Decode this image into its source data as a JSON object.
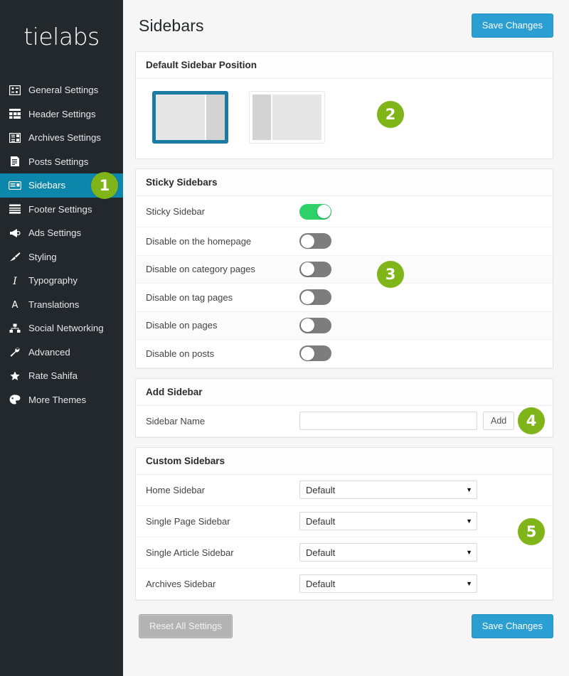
{
  "sidebar": {
    "logo": "tielabs",
    "items": [
      {
        "label": "General Settings",
        "icon": "general-settings-icon",
        "active": false
      },
      {
        "label": "Header Settings",
        "icon": "header-settings-icon",
        "active": false
      },
      {
        "label": "Archives Settings",
        "icon": "archives-settings-icon",
        "active": false
      },
      {
        "label": "Posts Settings",
        "icon": "posts-settings-icon",
        "active": false
      },
      {
        "label": "Sidebars",
        "icon": "sidebars-icon",
        "active": true
      },
      {
        "label": "Footer Settings",
        "icon": "footer-settings-icon",
        "active": false
      },
      {
        "label": "Ads Settings",
        "icon": "megaphone-icon",
        "active": false
      },
      {
        "label": "Styling",
        "icon": "brush-icon",
        "active": false
      },
      {
        "label": "Typography",
        "icon": "italic-text-icon",
        "active": false
      },
      {
        "label": "Translations",
        "icon": "letter-a-icon",
        "active": false
      },
      {
        "label": "Social Networking",
        "icon": "network-share-icon",
        "active": false
      },
      {
        "label": "Advanced",
        "icon": "wrench-icon",
        "active": false
      },
      {
        "label": "Rate Sahifa",
        "icon": "star-icon",
        "active": false
      },
      {
        "label": "More Themes",
        "icon": "palette-icon",
        "active": false
      }
    ]
  },
  "header": {
    "title": "Sidebars",
    "save_label": "Save Changes"
  },
  "panels": {
    "default_position": {
      "title": "Default Sidebar Position",
      "options": [
        {
          "name": "right-sidebar-layout",
          "selected": true
        },
        {
          "name": "left-sidebar-layout",
          "selected": false
        }
      ]
    },
    "sticky": {
      "title": "Sticky Sidebars",
      "rows": [
        {
          "label": "Sticky Sidebar",
          "on": true
        },
        {
          "label": "Disable on the homepage",
          "on": false
        },
        {
          "label": "Disable on category pages",
          "on": false
        },
        {
          "label": "Disable on tag pages",
          "on": false
        },
        {
          "label": "Disable on pages",
          "on": false
        },
        {
          "label": "Disable on posts",
          "on": false
        }
      ]
    },
    "add_sidebar": {
      "title": "Add Sidebar",
      "field_label": "Sidebar Name",
      "field_value": "",
      "field_placeholder": "",
      "add_label": "Add"
    },
    "custom_sidebars": {
      "title": "Custom Sidebars",
      "rows": [
        {
          "label": "Home Sidebar",
          "value": "Default"
        },
        {
          "label": "Single Page Sidebar",
          "value": "Default"
        },
        {
          "label": "Single Article Sidebar",
          "value": "Default"
        },
        {
          "label": "Archives Sidebar",
          "value": "Default"
        }
      ],
      "caret": "▼"
    }
  },
  "footer": {
    "reset_label": "Reset All Settings",
    "save_label": "Save Changes"
  },
  "badges": [
    {
      "number": "1"
    },
    {
      "number": "2"
    },
    {
      "number": "3"
    },
    {
      "number": "4"
    },
    {
      "number": "5"
    }
  ],
  "colors": {
    "sidebar_bg": "#23282d",
    "active_item": "#0d86ab",
    "badge_green": "#7fb519",
    "primary_blue": "#2b9fd1",
    "toggle_on": "#2ed06a",
    "toggle_off": "#7d7d7d",
    "selected_layout_border": "#1b7ba3"
  }
}
